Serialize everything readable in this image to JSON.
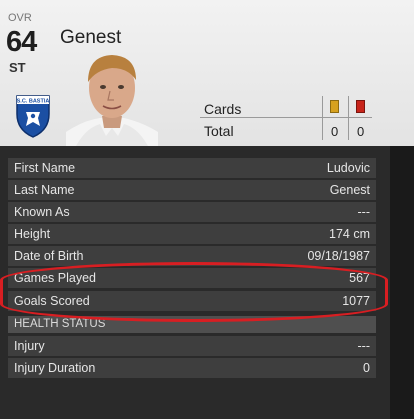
{
  "header": {
    "ovr_label": "OVR",
    "ovr_value": "64",
    "position": "ST",
    "player_name": "Genest",
    "club_crest_text": "S.C. BASTIA"
  },
  "cards": {
    "label": "Cards",
    "total_label": "Total",
    "yellow_total": "0",
    "red_total": "0",
    "yellow_color": "#d7a11e",
    "red_color": "#c8241a"
  },
  "details": [
    {
      "label": "First Name",
      "value": "Ludovic"
    },
    {
      "label": "Last Name",
      "value": "Genest"
    },
    {
      "label": "Known As",
      "value": "---"
    },
    {
      "label": "Height",
      "value": "174 cm"
    },
    {
      "label": "Date of Birth",
      "value": "09/18/1987"
    },
    {
      "label": "Games Played",
      "value": "567"
    },
    {
      "label": "Goals Scored",
      "value": "1077"
    }
  ],
  "health": {
    "title": "HEALTH STATUS",
    "rows": [
      {
        "label": "Injury",
        "value": "---"
      },
      {
        "label": "Injury Duration",
        "value": "0"
      }
    ]
  },
  "colors": {
    "highlight": "#d81e22",
    "row_bg": "#3e3e3e",
    "panel_bg": "#2a2a2a"
  }
}
